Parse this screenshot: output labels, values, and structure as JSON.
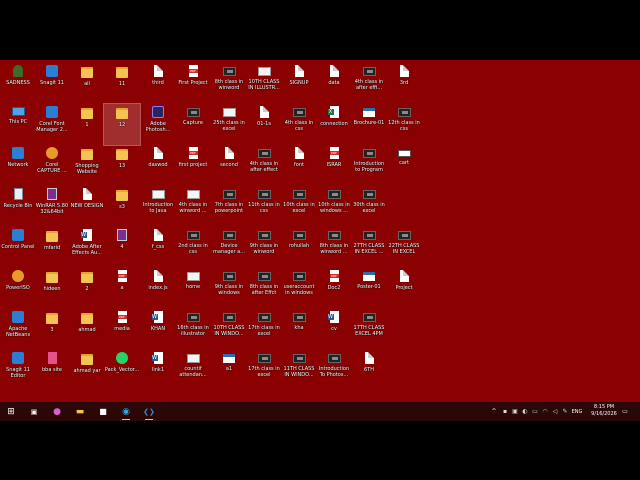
{
  "desktop": {
    "icons": [
      [
        "SADNESS",
        "Snagit 11",
        "all",
        "11",
        "third",
        "First Project",
        "8th class in winword",
        "10TH CLASS IN ILLUSTR...",
        "SIGNUP",
        "data",
        "4th class in after effi...",
        "3rd"
      ],
      [
        "This PC",
        "Corel Font Manager 2...",
        "1",
        "12",
        "Adobe Photosh...",
        "Capture",
        "25th class in excel",
        "01-1s",
        "4th class in css",
        "connection",
        "Brochure-01",
        "12th class in css"
      ],
      [
        "Network",
        "Corel CAPTURE ...",
        "Shopping Website",
        "13",
        "daswod",
        "first project",
        "second",
        "4th class in after effect",
        "font",
        "ISRAR",
        "Introduction to Program",
        "cart"
      ],
      [
        "Recycle Bin",
        "WinRAR 5.80 32&64bit",
        "NEW DESIGN",
        "s3",
        "Introduction to Java",
        "4th class in winword ...",
        "7th class in powerpoint",
        "11th class in css",
        "10th class in excel",
        "10th class in windows ...",
        "30th class in excel"
      ],
      [
        "Control Panel",
        "mfarid",
        "Adobe After Effects Au...",
        "4",
        "f_css",
        "2nd class in css",
        "Device manager a...",
        "9th class in winword",
        "rohullah",
        "8th class in winword ...",
        "27TH CLASS IN EXCEL ...",
        "22TH CLASS IN EXCEL"
      ],
      [
        "PowerISO",
        "hideen",
        "2",
        "a",
        "index.js",
        "home",
        "9th class in windows",
        "8th class in after Effct",
        "useraccount in windows",
        "Doc2",
        "Poster-01",
        "Project"
      ],
      [
        "Apache NetBeans",
        "3",
        "ahmad",
        "media",
        "KHAN",
        "16th class in illustrator",
        "10TH CLASS IN WINDO...",
        "17th class in excel",
        "kha",
        "cv",
        "17TH CLASS EXCEL 4PM"
      ],
      [
        "Snagit 11 Editor",
        "bba site",
        "ahmad yar",
        "Pack_Vector...",
        "link1",
        "countif attendan...",
        "a1",
        "17th class in excel",
        "11TH CLASS IN WINDO...",
        "Introduction To Photos...",
        "6TH"
      ]
    ],
    "selected_icon": "12"
  },
  "taskbar": {
    "items": [
      {
        "name": "start-button",
        "glyph": "⊞",
        "color": "#ffffff"
      },
      {
        "name": "task-view-button",
        "glyph": "▣",
        "color": "#ffffff"
      },
      {
        "name": "copilot-button",
        "glyph": "●",
        "color": "#d95fd0"
      },
      {
        "name": "file-explorer-button",
        "glyph": "▬",
        "color": "#f3c451"
      },
      {
        "name": "store-button",
        "glyph": "■",
        "color": "#ffffff"
      },
      {
        "name": "edge-button",
        "glyph": "◉",
        "color": "#2fa8e0"
      },
      {
        "name": "vscode-button",
        "glyph": "❮❯",
        "color": "#2f8fd8"
      }
    ],
    "tray": {
      "chevron": "^",
      "language": "ENG",
      "time": "8:15 PM",
      "date": "9/16/2026"
    }
  },
  "colors": {
    "desktop_bg": "#8b0000",
    "taskbar_bg": "#2a0808"
  }
}
